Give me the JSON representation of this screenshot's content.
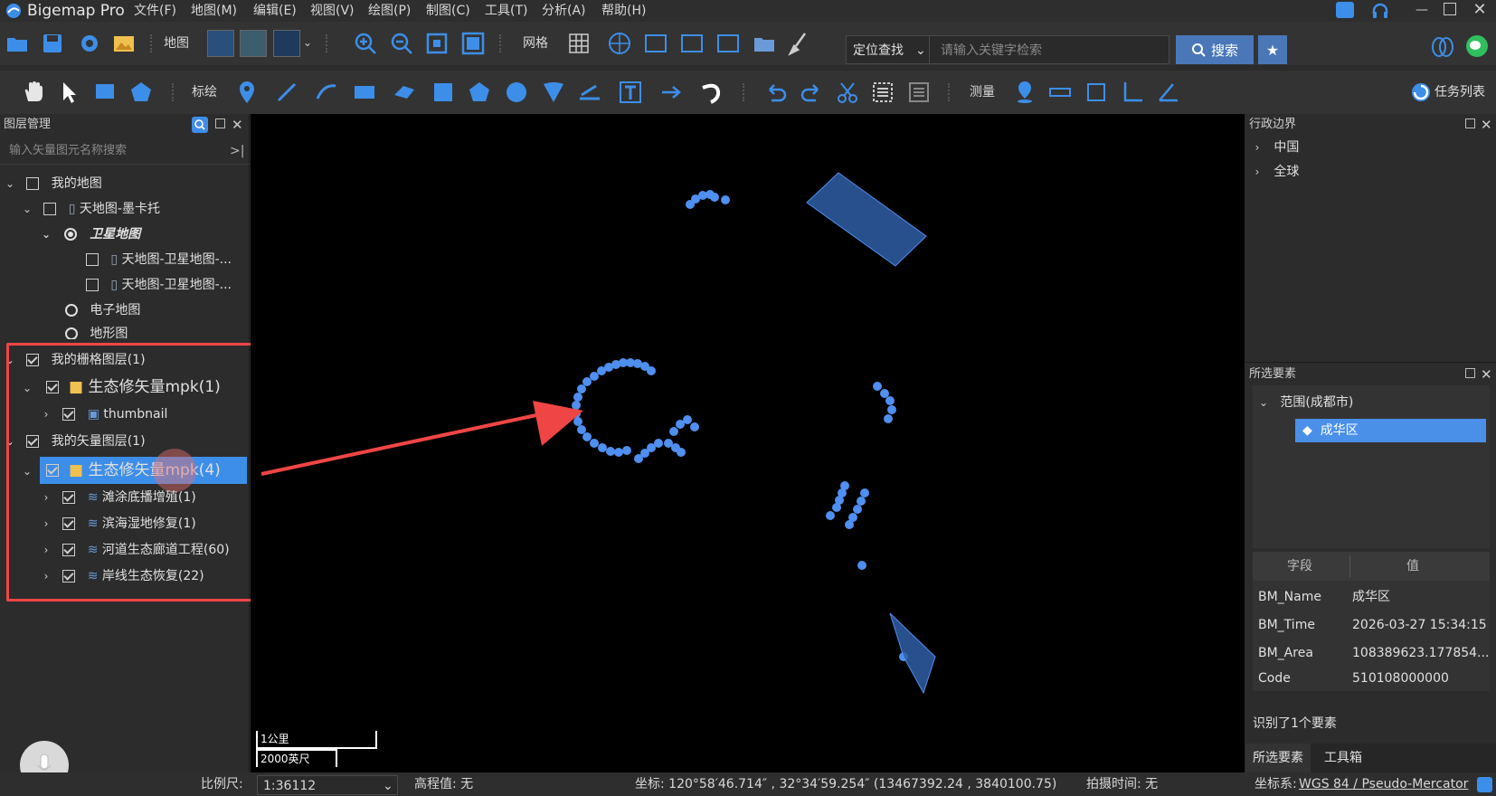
{
  "app": {
    "title": "Bigemap Pro"
  },
  "menu": [
    "文件(F)",
    "地图(M)",
    "编辑(E)",
    "视图(V)",
    "绘图(P)",
    "制图(C)",
    "工具(T)",
    "分析(A)",
    "帮助(H)"
  ],
  "toolbar1": {
    "map_label": "地图",
    "grid_label": "网格",
    "locate_dropdown": "定位查找",
    "search_placeholder": "请输入关键字检索",
    "search_button": "搜索"
  },
  "toolbar2": {
    "draw_label": "标绘",
    "measure_label": "测量",
    "tasks_label": "任务列表"
  },
  "layer_panel": {
    "title": "图层管理",
    "search_placeholder": "输入矢量图元名称搜索",
    "tree": {
      "my_map": "我的地图",
      "tianditu": "天地图-墨卡托",
      "satellite": "卫星地图",
      "sat_child1": "天地图-卫星地图-...",
      "sat_child2": "天地图-卫星地图-...",
      "electronic": "电子地图",
      "terrain": "地形图",
      "raster_layers": "我的栅格图层(1)",
      "raster_mpk": "生态修矢量mpk(1)",
      "thumbnail": "thumbnail",
      "vector_layers": "我的矢量图层(1)",
      "vector_mpk": "生态修矢量mpk(4)",
      "v1": "滩涂底播增殖(1)",
      "v2": "滨海湿地修复(1)",
      "v3": "河道生态廊道工程(60)",
      "v4": "岸线生态恢复(22)"
    }
  },
  "admin_panel": {
    "title": "行政边界",
    "items": [
      "中国",
      "全球"
    ]
  },
  "selected_panel": {
    "title": "所选要素",
    "group": "范围(成都市)",
    "item": "成华区",
    "table_headers": [
      "字段",
      "值"
    ],
    "rows": [
      {
        "field": "BM_Name",
        "value": "成华区"
      },
      {
        "field": "BM_Time",
        "value": "2026-03-27 15:34:15"
      },
      {
        "field": "BM_Area",
        "value": "108389623.177854..."
      },
      {
        "field": "Code",
        "value": "510108000000"
      }
    ],
    "summary": "识别了1个要素",
    "tabs": [
      "所选要素",
      "工具箱"
    ]
  },
  "map": {
    "scale_metric": "1公里",
    "scale_imperial": "2000英尺"
  },
  "status": {
    "scale_label": "比例尺:",
    "scale_value": "1:36112",
    "elevation": "高程值: 无",
    "coordinate": "坐标: 120°58′46.714″ , 32°34′59.254″   (13467392.24 , 3840100.75)",
    "capture_time": "拍摄时间: 无",
    "crs_label": "坐标系:",
    "crs_value": "WGS 84 / Pseudo-Mercator"
  },
  "colors": {
    "accent": "#4a77b8",
    "highlight": "#3d8ee8",
    "annotation_red": "#f04545",
    "feature_blue": "#4f8ff0"
  }
}
